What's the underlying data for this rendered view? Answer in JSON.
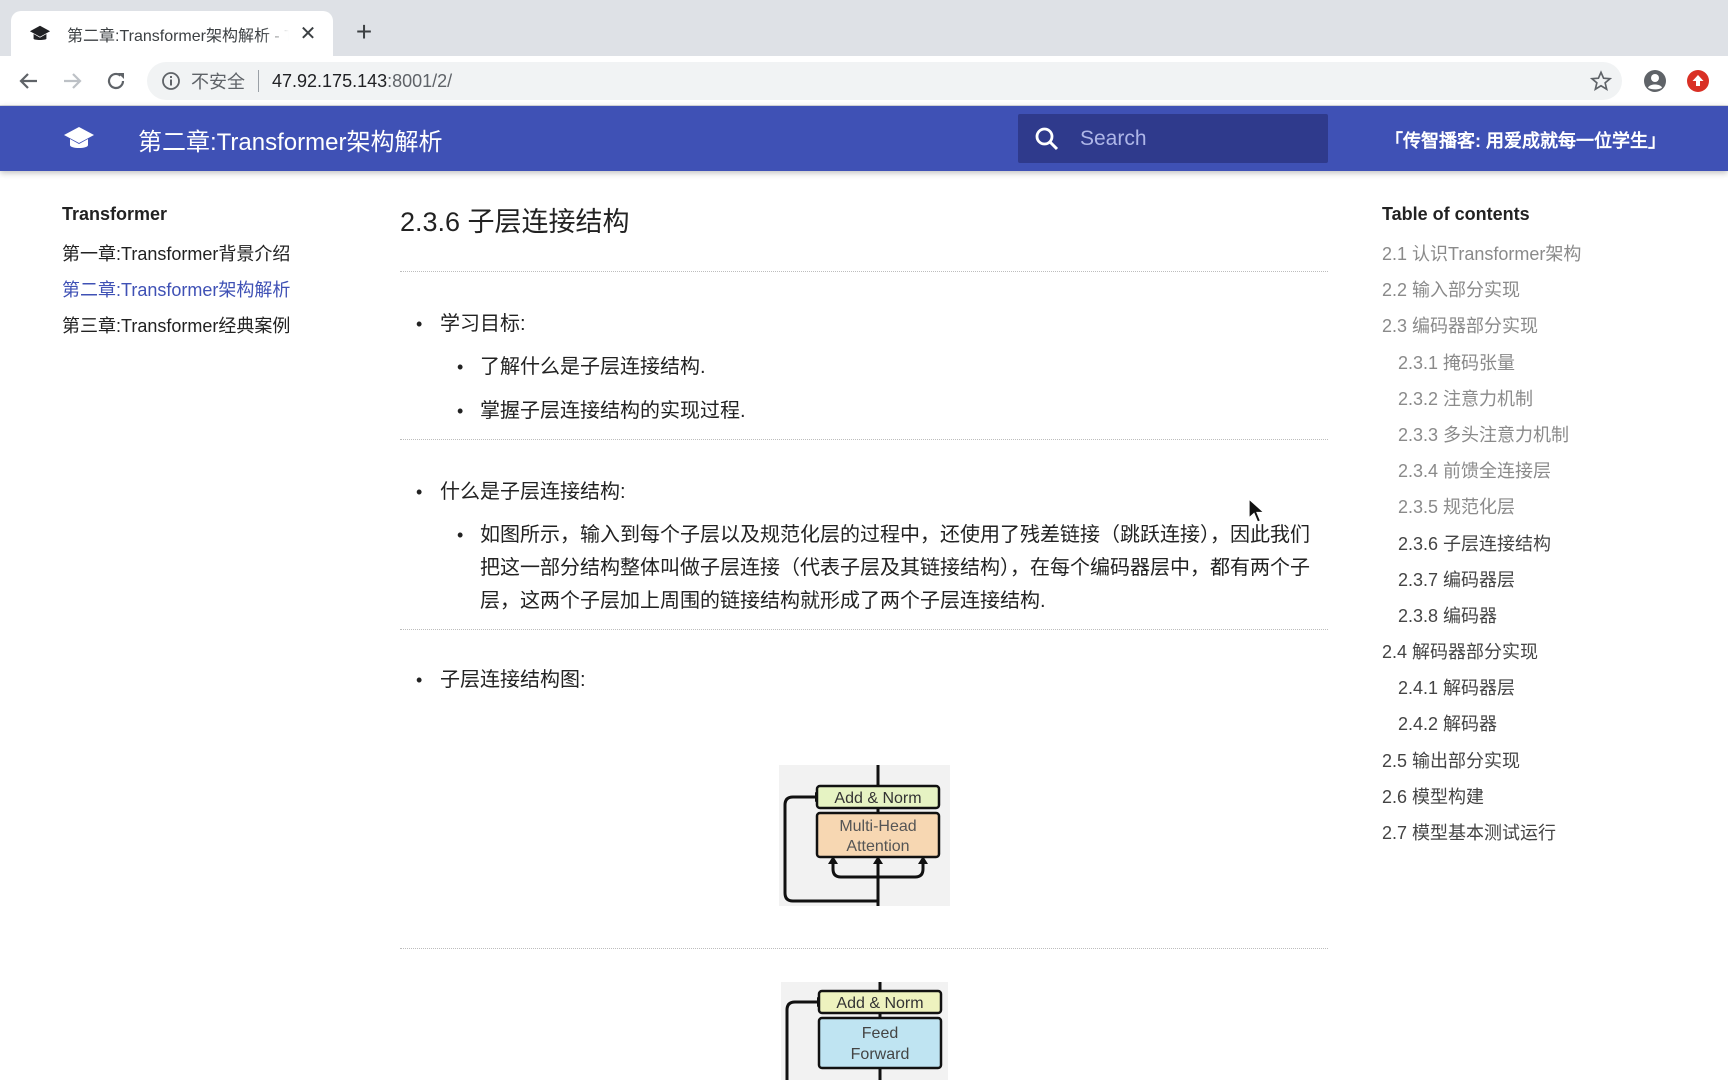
{
  "browser": {
    "tab_title": "第二章:Transformer架构解析 - Transformer",
    "new_tab_label": "+",
    "close_tab_label": "✕",
    "security_label": "不安全",
    "url_host": "47.92.175.143",
    "url_rest": ":8001/2/"
  },
  "header": {
    "site_title": "第二章:Transformer架构解析",
    "search_placeholder": "Search",
    "tagline": "「传智播客: 用爱成就每一位学生」",
    "brand_color": "#3f51b5"
  },
  "leftnav": {
    "heading": "Transformer",
    "items": [
      {
        "label": "第一章:Transformer背景介绍",
        "active": false
      },
      {
        "label": "第二章:Transformer架构解析",
        "active": true
      },
      {
        "label": "第三章:Transformer经典案例",
        "active": false
      }
    ]
  },
  "main": {
    "title": "2.3.6 子层连接结构",
    "sections": [
      {
        "heading": "学习目标:",
        "items": [
          "了解什么是子层连接结构.",
          "掌握子层连接结构的实现过程."
        ]
      },
      {
        "heading": "什么是子层连接结构:",
        "items": [
          "如图所示，输入到每个子层以及规范化层的过程中，还使用了残差链接（跳跃连接），因此我们把这一部分结构整体叫做子层连接（代表子层及其链接结构），在每个编码器层中，都有两个子层，这两个子层加上周围的链接结构就形成了两个子层连接结构."
        ]
      },
      {
        "heading": "子层连接结构图:"
      }
    ],
    "figures": [
      {
        "top_label": "Add & Norm",
        "block_label_1": "Multi-Head",
        "block_label_2": "Attention",
        "block_color": "#f7d7b2"
      },
      {
        "top_label": "Add & Norm",
        "block_label_1": "Feed",
        "block_label_2": "Forward",
        "block_color": "#bfe4f2"
      }
    ]
  },
  "toc": {
    "heading": "Table of contents",
    "items": [
      {
        "label": "2.1 认识Transformer架构",
        "level": 1,
        "passed": true
      },
      {
        "label": "2.2 输入部分实现",
        "level": 1,
        "passed": true
      },
      {
        "label": "2.3 编码器部分实现",
        "level": 1,
        "passed": true
      },
      {
        "label": "2.3.1 掩码张量",
        "level": 2,
        "passed": true
      },
      {
        "label": "2.3.2 注意力机制",
        "level": 2,
        "passed": true
      },
      {
        "label": "2.3.3 多头注意力机制",
        "level": 2,
        "passed": true
      },
      {
        "label": "2.3.4 前馈全连接层",
        "level": 2,
        "passed": true
      },
      {
        "label": "2.3.5 规范化层",
        "level": 2,
        "passed": true
      },
      {
        "label": "2.3.6 子层连接结构",
        "level": 2,
        "passed": false
      },
      {
        "label": "2.3.7 编码器层",
        "level": 2,
        "passed": false
      },
      {
        "label": "2.3.8 编码器",
        "level": 2,
        "passed": false
      },
      {
        "label": "2.4 解码器部分实现",
        "level": 1,
        "passed": false
      },
      {
        "label": "2.4.1 解码器层",
        "level": 2,
        "passed": false
      },
      {
        "label": "2.4.2 解码器",
        "level": 2,
        "passed": false
      },
      {
        "label": "2.5 输出部分实现",
        "level": 1,
        "passed": false
      },
      {
        "label": "2.6 模型构建",
        "level": 1,
        "passed": false
      },
      {
        "label": "2.7 模型基本测试运行",
        "level": 1,
        "passed": false
      }
    ]
  }
}
